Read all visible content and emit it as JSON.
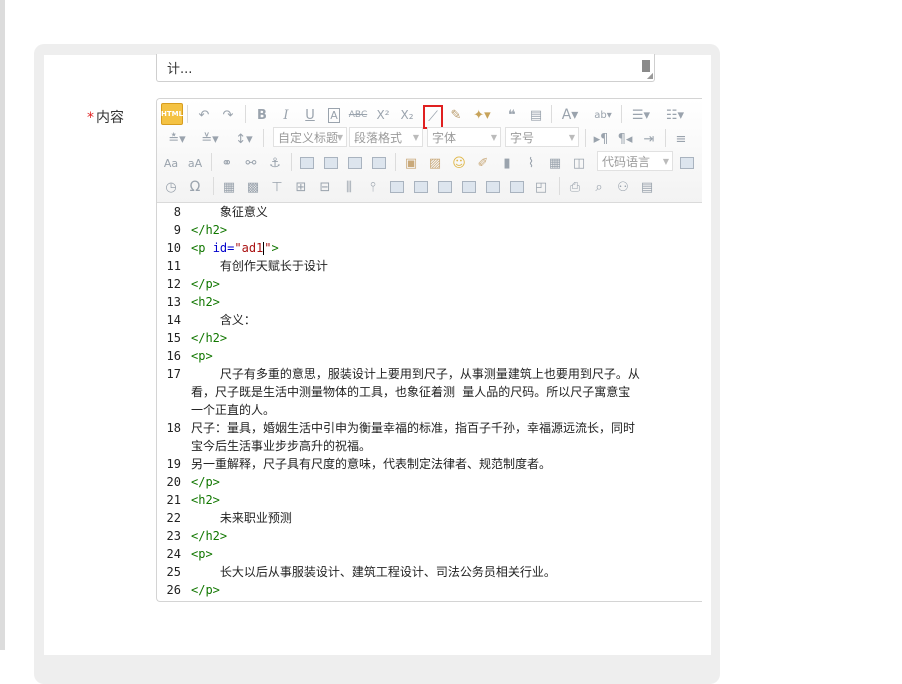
{
  "field": {
    "required_mark": "*",
    "label": "内容"
  },
  "previous_field": {
    "text": "计..."
  },
  "toolbar": {
    "html_button": "HTML",
    "combos": {
      "custom_title": "自定义标题",
      "paragraph": "段落格式",
      "font_family": "字体",
      "font_size": "字号",
      "code_language": "代码语言"
    },
    "highlighted_button": "link-icon",
    "highlight_color": "#e02020"
  },
  "code_lines": [
    {
      "n": "8",
      "indent": true,
      "text": "象征意义"
    },
    {
      "n": "9",
      "tag": "</h2>"
    },
    {
      "n": "10",
      "p_attr": true,
      "tag_open": "<p ",
      "attr": "id=",
      "val": "\"ad1",
      "after": "\">"
    },
    {
      "n": "11",
      "indent": true,
      "text": "有创作天赋长于设计"
    },
    {
      "n": "12",
      "tag": "</p>"
    },
    {
      "n": "13",
      "tag": "<h2>"
    },
    {
      "n": "14",
      "indent": true,
      "text": "含义："
    },
    {
      "n": "15",
      "tag": "</h2>"
    },
    {
      "n": "16",
      "tag": "<p>"
    },
    {
      "n": "17",
      "indent": true,
      "text": "尺子有多重的意思，服装设计上要用到尺子，从事测量建筑上也要用到尺子。从"
    },
    {
      "n": "",
      "text": "看，尺子既是生活中测量物体的工具，也象征着测 量人品的尺码。所以尺子寓意宝"
    },
    {
      "n": "",
      "text": "一个正直的人。"
    },
    {
      "n": "18",
      "text": "尺子：量具，婚姻生活中引申为衡量幸福的标准，指百子千孙，幸福源远流长，同时"
    },
    {
      "n": "",
      "text": "宝今后生活事业步步高升的祝福。"
    },
    {
      "n": "19",
      "text": "另一重解释，尺子具有尺度的意味，代表制定法律者、规范制度者。"
    },
    {
      "n": "20",
      "tag": "</p>"
    },
    {
      "n": "21",
      "tag": "<h2>"
    },
    {
      "n": "22",
      "indent": true,
      "text": "未来职业预测"
    },
    {
      "n": "23",
      "tag": "</h2>"
    },
    {
      "n": "24",
      "tag": "<p>"
    },
    {
      "n": "25",
      "indent": true,
      "text": "长大以后从事服装设计、建筑工程设计、司法公务员相关行业。"
    },
    {
      "n": "26",
      "tag": "</p>"
    }
  ]
}
